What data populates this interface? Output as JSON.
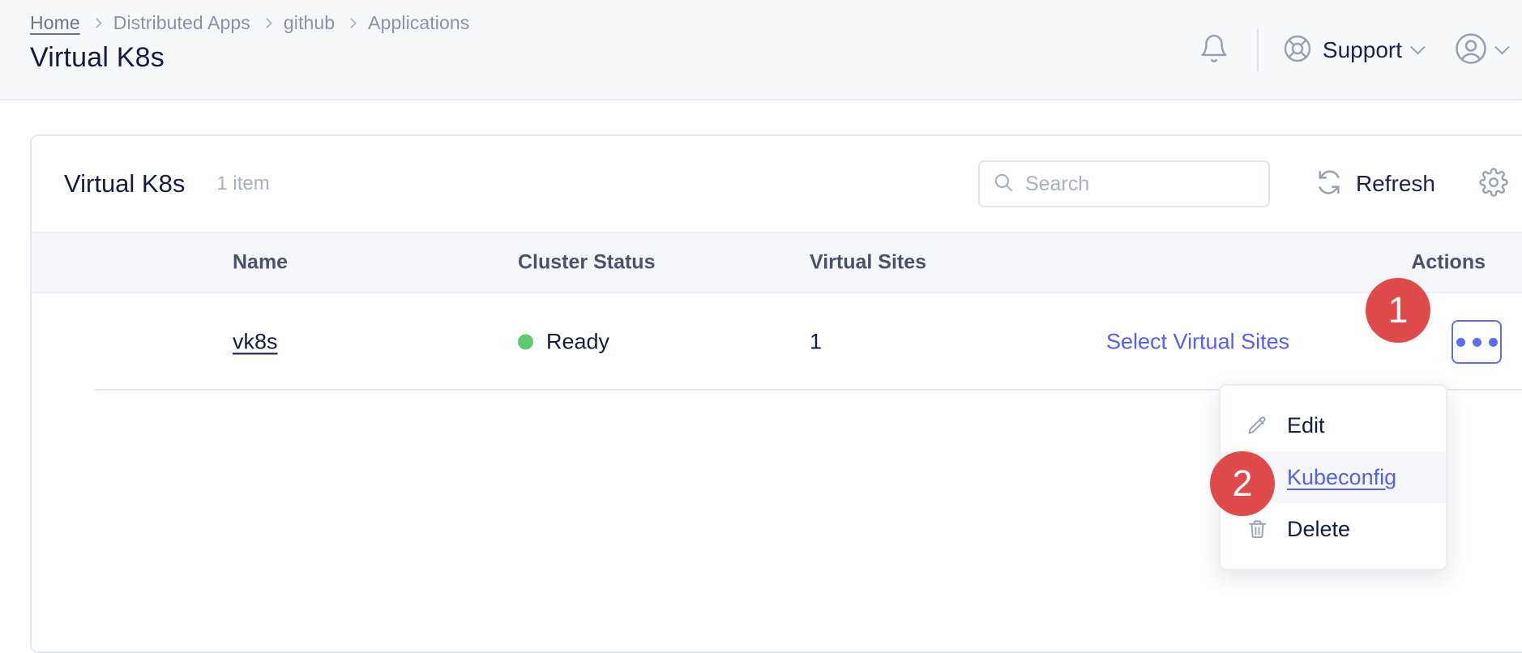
{
  "header": {
    "breadcrumb": [
      {
        "label": "Home",
        "current": false
      },
      {
        "label": "Distributed Apps",
        "current": false
      },
      {
        "label": "github",
        "current": false
      },
      {
        "label": "Applications",
        "current": true
      }
    ],
    "page_title": "Virtual K8s",
    "notifications_icon": "bell-icon",
    "support_label": "Support",
    "support_icon": "lifebuoy-icon",
    "account_icon": "user-avatar-icon"
  },
  "card": {
    "title": "Virtual K8s",
    "count_label": "1 item",
    "search": {
      "value": "",
      "placeholder": "Search",
      "icon": "search-icon"
    },
    "refresh_label": "Refresh",
    "refresh_icon": "refresh-icon",
    "settings_icon": "gear-icon"
  },
  "table": {
    "columns": [
      "Name",
      "Cluster Status",
      "Virtual Sites",
      "Actions"
    ],
    "rows": [
      {
        "name": "vk8s",
        "cluster_status": "Ready",
        "status_color": "#5ecb6e",
        "virtual_sites": "1",
        "action_link": "Select Virtual Sites",
        "kebab_icon": "ellipsis-icon"
      }
    ]
  },
  "menu": {
    "items": [
      {
        "label": "Edit",
        "icon": "pencil-icon",
        "active": false
      },
      {
        "label": "Kubeconfig",
        "icon": "download-icon",
        "active": true
      },
      {
        "label": "Delete",
        "icon": "trash-icon",
        "active": false
      }
    ]
  },
  "annotations": {
    "badge_1": "1",
    "badge_2": "2",
    "badge_color": "#e04a4a"
  },
  "colors": {
    "accent_blue": "#5161f0",
    "text_dark": "#151c44",
    "muted": "#a9b0c2",
    "page_bg": "#f7f8fa"
  }
}
